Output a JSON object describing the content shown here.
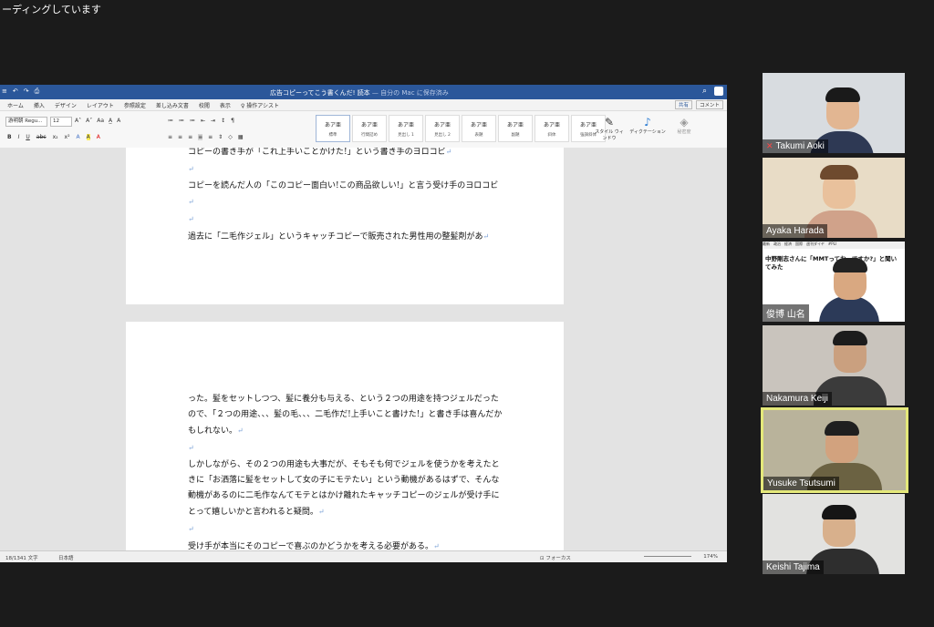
{
  "banner": "ーディングしています",
  "word": {
    "quick_access": [
      "≡",
      "↶",
      "↷",
      "⎙"
    ],
    "title": "広告コピーってこう書くんだ! 読本",
    "saved_status": " — 自分の Mac に保存済み",
    "menu": [
      "ホーム",
      "挿入",
      "デザイン",
      "レイアウト",
      "参照設定",
      "差し込み文書",
      "校閲",
      "表示",
      "操作アシスト"
    ],
    "share_label": "共有",
    "comment_label": "コメント",
    "font_name": "游明朝 Regu...",
    "font_size": "12",
    "font_tools_row1": [
      "A˄",
      "A˅",
      "Aa",
      "A̲",
      "A"
    ],
    "font_tools_row2": [
      "B",
      "I",
      "U",
      "abc",
      "x₂",
      "x²",
      "A",
      "A",
      "A"
    ],
    "para_tools_row1": [
      "≔",
      "≔",
      "≔",
      "⇤",
      "⇥",
      "↕",
      "¶"
    ],
    "para_tools_row2": [
      "≡",
      "≡",
      "≡",
      "≡",
      "≡",
      "⇕",
      "◇",
      "▦"
    ],
    "styles": [
      {
        "sample": "あア亜",
        "name": "標準"
      },
      {
        "sample": "あア亜",
        "name": "行間詰め"
      },
      {
        "sample": "あア亜",
        "name": "見出し 1"
      },
      {
        "sample": "あア亜",
        "name": "見出し 2"
      },
      {
        "sample": "あア亜",
        "name": "表題"
      },
      {
        "sample": "あア亜",
        "name": "副題"
      },
      {
        "sample": "あア亜",
        "name": "斜体"
      },
      {
        "sample": "あア亜",
        "name": "強調斜体"
      }
    ],
    "style_pane_label": "スタイル ウィンドウ",
    "dictation_label": "ディクテーション",
    "sensitivity_label": "秘密度",
    "page1_paragraphs": [
      "コピーの書き手が「これ上手いことかけた!」という書き手のヨロコビ",
      "",
      "コピーを読んだ人の「このコピー面白い!この商品欲しい!」と言う受け手のヨロコビ",
      "",
      "過去に「二毛作ジェル」というキャッチコピーで販売された男性用の整髪剤があ"
    ],
    "page2_paragraphs": [
      "った。髪をセットしつつ、髪に養分も与える、という２つの用途を持つジェルだったので、「２つの用途、、、髪の毛、、、二毛作だ!上手いこと書けた!」と書き手は喜んだかもしれない。",
      "",
      "しかしながら、その２つの用途も大事だが、そもそも何でジェルを使うかを考えたときに「お洒落に髪をセットして女の子にモテたい」という動機があるはずで、そんな動機があるのに二毛作なんてモテとはかけ離れたキャッチコピーのジェルが受け手にとって嬉しいかと言われると疑問。",
      "",
      "受け手が本当にそのコピーで喜ぶのかどうかを考える必要がある。",
      ""
    ],
    "status_words": "18/1341 文字",
    "status_lang": "日本語",
    "status_focus": "フォーカス",
    "status_zoom": "174%"
  },
  "participants": [
    {
      "name": "Takumi Aoki",
      "muted": true
    },
    {
      "name": "Ayaka Harada",
      "muted": false
    },
    {
      "name": "俊博 山名",
      "muted": false
    },
    {
      "name": "Nakamura Keiji",
      "muted": false
    },
    {
      "name": "Yusuke Tsutsumi",
      "muted": false
    },
    {
      "name": "Keishi Tajima",
      "muted": false
    }
  ],
  "shared_page": {
    "nav": [
      "最新",
      "政治",
      "経済",
      "国際",
      "週刊ダイヤ",
      "#PLI"
    ],
    "headline": "中野剛志さんに「MMTってお…ですか?」と聞いてみた"
  },
  "colors": {
    "word_blue": "#2b579a",
    "active_speaker": "#e4e87a",
    "mute_red": "#ff4444"
  }
}
